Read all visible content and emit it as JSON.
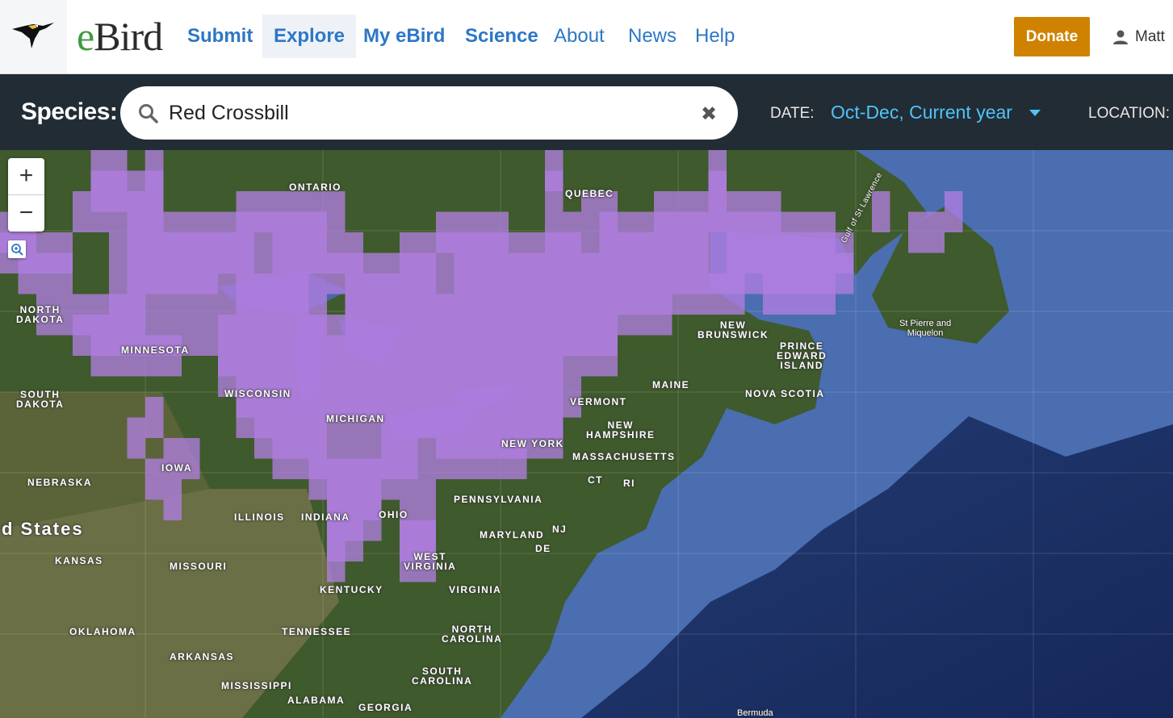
{
  "nav": {
    "logo_text_e": "e",
    "logo_text_rest": "Bird",
    "items": [
      {
        "label": "Submit"
      },
      {
        "label": "Explore"
      },
      {
        "label": "My eBird"
      },
      {
        "label": "Science"
      },
      {
        "label": "About"
      },
      {
        "label": "News"
      },
      {
        "label": "Help"
      }
    ],
    "donate_label": "Donate",
    "user_name": "Matt"
  },
  "filters": {
    "species_label": "Species:",
    "species_value": "Red Crossbill",
    "date_label": "DATE:",
    "date_value": "Oct-Dec,  Current year",
    "location_label": "LOCATION:"
  },
  "map": {
    "zoom_in": "+",
    "zoom_out": "−",
    "labels": [
      {
        "text": "ONTARIO"
      },
      {
        "text": "QUEBEC"
      },
      {
        "text": "NORTH\nDAKOTA"
      },
      {
        "text": "MINNESOTA"
      },
      {
        "text": "SOUTH\nDAKOTA"
      },
      {
        "text": "WISCONSIN"
      },
      {
        "text": "MICHIGAN"
      },
      {
        "text": "IOWA"
      },
      {
        "text": "NEBRASKA"
      },
      {
        "text": "ILLINOIS"
      },
      {
        "text": "INDIANA"
      },
      {
        "text": "OHIO"
      },
      {
        "text": "d States"
      },
      {
        "text": "KANSAS"
      },
      {
        "text": "MISSOURI"
      },
      {
        "text": "KENTUCKY"
      },
      {
        "text": "WEST\nVIRGINIA"
      },
      {
        "text": "VIRGINIA"
      },
      {
        "text": "OKLAHOMA"
      },
      {
        "text": "TENNESSEE"
      },
      {
        "text": "NORTH\nCAROLINA"
      },
      {
        "text": "ARKANSAS"
      },
      {
        "text": "SOUTH\nCAROLINA"
      },
      {
        "text": "MISSISSIPPI"
      },
      {
        "text": "ALABAMA"
      },
      {
        "text": "GEORGIA"
      },
      {
        "text": "NEW YORK"
      },
      {
        "text": "PENNSYLVANIA"
      },
      {
        "text": "VERMONT"
      },
      {
        "text": "NEW\nHAMPSHIRE"
      },
      {
        "text": "MASSACHUSETTS"
      },
      {
        "text": "CT"
      },
      {
        "text": "RI"
      },
      {
        "text": "NJ"
      },
      {
        "text": "MARYLAND"
      },
      {
        "text": "DE"
      },
      {
        "text": "MAINE"
      },
      {
        "text": "NEW\nBRUNSWICK"
      },
      {
        "text": "PRINCE\nEDWARD\nISLAND"
      },
      {
        "text": "NOVA SCOTIA"
      },
      {
        "text": "St Pierre and\nMiquelon"
      },
      {
        "text": "Gulf of St Lawrence"
      },
      {
        "text": "Bermuda"
      }
    ]
  }
}
